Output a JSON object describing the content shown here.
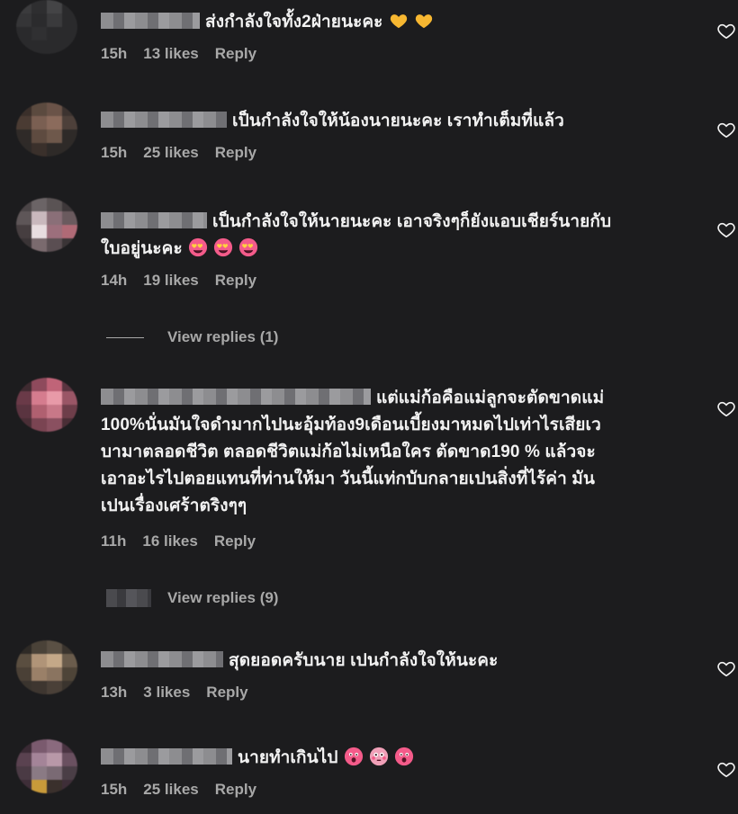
{
  "comments": [
    {
      "text": "ส่งกำลังใจทั้ง2ฝ่ายนะคะ",
      "emojis": [
        "yellow-heart",
        "yellow-heart"
      ],
      "time": "15h",
      "likes": "13 likes",
      "reply": "Reply"
    },
    {
      "text": "เป็นกำลังใจให้น้องนายนะคะ เราทำเต็มที่แล้ว",
      "time": "15h",
      "likes": "25 likes",
      "reply": "Reply"
    },
    {
      "text_line1": "เป็นกำลังใจให้นายนะคะ เอาจริงๆก็ยังแอบเชียร์นายกับ",
      "text_line2": "ใบอยู่นะคะ",
      "emojis": [
        "heart-eyes-face",
        "heart-eyes-face",
        "heart-eyes-face"
      ],
      "time": "14h",
      "likes": "19 likes",
      "reply": "Reply",
      "view_replies": "View replies (1)"
    },
    {
      "text_line1": "แต่แม่ก้อคือแม่ลูกจะตัดขาดแม่",
      "text_line2": "100%นั่นมันใจดำมากไปนะอุ้มท้อง9เดือนเบี้ยงมาหมดไปเท่าไรเสียเว",
      "text_line3": "บามาตลอดชีวิต ตลอดชีวิตแม่ก้อไม่เหนือใคร ตัดขาด190 % แล้วจะ",
      "text_line4": "เอาอะไรไปตอยแทนที่ท่านให้มา วันนี้แท่กบับกลายเปนสิ่งที่ไร้ค่า มัน",
      "text_line5": "เปนเรื่องเศร้าตริงๆๆ",
      "time": "11h",
      "likes": "16 likes",
      "reply": "Reply",
      "view_replies": "View replies (9)"
    },
    {
      "text": "สุดยอดครับนาย เปนกำลังใจให้นะคะ",
      "time": "13h",
      "likes": "3 likes",
      "reply": "Reply"
    },
    {
      "text": "นายทำเกินไป",
      "emojis": [
        "astonished-face",
        "flushed-face",
        "astonished-face"
      ],
      "time": "15h",
      "likes": "25 likes",
      "reply": "Reply"
    }
  ],
  "colors": {
    "background": "#1c1c1e",
    "text": "#f2f2f2",
    "meta": "#a8a8a8",
    "yellow_heart": "#f7b731",
    "emoji_face": "#f45b8a"
  },
  "icons": {
    "like": "heart-outline-icon"
  }
}
